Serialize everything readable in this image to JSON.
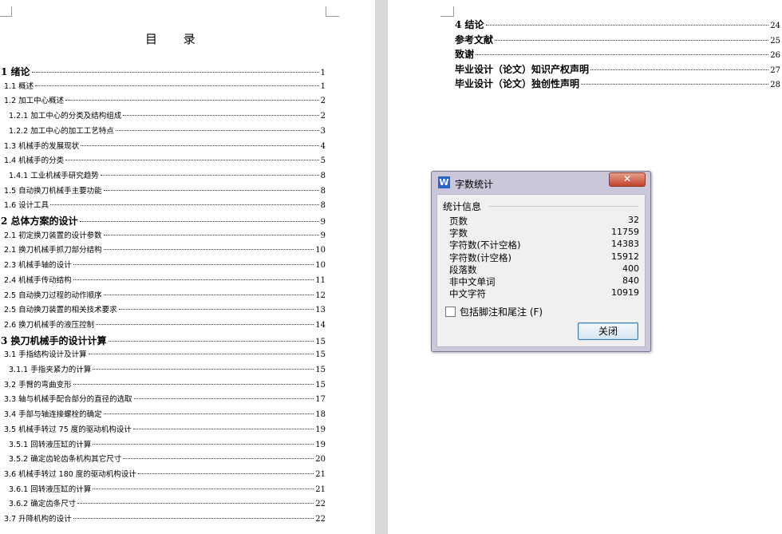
{
  "left_page": {
    "toc_title": "目  录",
    "entries": [
      {
        "label": "1 绪论",
        "page": "1",
        "level": 1
      },
      {
        "label": "1.1 概述",
        "page": "1",
        "level": 2
      },
      {
        "label": "1.2 加工中心概述",
        "page": "2",
        "level": 2
      },
      {
        "label": "1.2.1 加工中心的分类及结构组成",
        "page": "2",
        "level": 3
      },
      {
        "label": "1.2.2 加工中心的加工工艺特点",
        "page": "3",
        "level": 3
      },
      {
        "label": "1.3 机械手的发展现状",
        "page": "4",
        "level": 2
      },
      {
        "label": "1.4 机械手的分类",
        "page": "5",
        "level": 2
      },
      {
        "label": "1.4.1 工业机械手研究趋势",
        "page": "8",
        "level": 3
      },
      {
        "label": "1.5 自动换刀机械手主要功能",
        "page": "8",
        "level": 2
      },
      {
        "label": "1.6 设计工具",
        "page": "8",
        "level": 2
      },
      {
        "label": "2 总体方案的设计",
        "page": "9",
        "level": 1
      },
      {
        "label": "2.1 初定换刀装置的设计参数",
        "page": "9",
        "level": 2
      },
      {
        "label": "2.1 换刀机械手抓刀部分结构",
        "page": "10",
        "level": 2
      },
      {
        "label": "2.3 机械手轴的设计",
        "page": "10",
        "level": 2
      },
      {
        "label": "2.4 机械手传动结构",
        "page": "11",
        "level": 2
      },
      {
        "label": "2.5 自动换刀过程的动作顺序",
        "page": "12",
        "level": 2
      },
      {
        "label": "2.5 自动换刀装置的相关技术要求",
        "page": "13",
        "level": 2
      },
      {
        "label": "2.6      换刀机械手的液压控制",
        "page": "14",
        "level": 2
      },
      {
        "label": "3 换刀机械手的设计计算",
        "page": "15",
        "level": 1
      },
      {
        "label": "3.1 手指结构设计及计算",
        "page": "15",
        "level": 2
      },
      {
        "label": "3.1.1 手指夹紧力的计算",
        "page": "15",
        "level": 3
      },
      {
        "label": "3.2 手臂的弯曲变形",
        "page": "15",
        "level": 2
      },
      {
        "label": "3.3 轴与机械手配合部分的直径的选取",
        "page": "17",
        "level": 2
      },
      {
        "label": "3.4 手部与轴连接螺栓的确定",
        "page": "18",
        "level": 2
      },
      {
        "label": "3.5 机械手转过 75 度的驱动机构设计",
        "page": "19",
        "level": 2
      },
      {
        "label": "3.5.1 回转液压缸的计算",
        "page": "19",
        "level": 3
      },
      {
        "label": "3.5.2 确定齿轮齿条机构其它尺寸",
        "page": "20",
        "level": 3
      },
      {
        "label": "3.6 机械手转过 180 度的驱动机构设计",
        "page": "21",
        "level": 2
      },
      {
        "label": "3.6.1 回转液压缸的计算",
        "page": "21",
        "level": 3
      },
      {
        "label": "3.6.2 确定齿条尺寸",
        "page": "22",
        "level": 3
      },
      {
        "label": "3.7 升降机构的设计",
        "page": "22",
        "level": 2
      }
    ]
  },
  "right_page": {
    "entries": [
      {
        "label": "4 结论",
        "page": "24",
        "level": 1
      },
      {
        "label": "参考文献",
        "page": "25",
        "level": 1
      },
      {
        "label": "致谢",
        "page": "26",
        "level": 1
      },
      {
        "label": "毕业设计（论文）知识产权声明",
        "page": "27",
        "level": 1
      },
      {
        "label": "毕业设计（论文）独创性声明",
        "page": "28",
        "level": 1
      }
    ]
  },
  "dialog": {
    "app_icon_glyph": "W",
    "title": "字数统计",
    "close_glyph": "✕",
    "group_label": "统计信息",
    "stats": [
      {
        "label": "页数",
        "value": "32"
      },
      {
        "label": "字数",
        "value": "11759"
      },
      {
        "label": "字符数(不计空格)",
        "value": "14383"
      },
      {
        "label": "字符数(计空格)",
        "value": "15912"
      },
      {
        "label": "段落数",
        "value": "400"
      },
      {
        "label": "非中文单词",
        "value": "840"
      },
      {
        "label": "中文字符",
        "value": "10919"
      }
    ],
    "checkbox_label": "包括脚注和尾注 (F)",
    "checkbox_checked": false,
    "close_button_label": "关闭",
    "accent_color": "#2b64c8"
  }
}
